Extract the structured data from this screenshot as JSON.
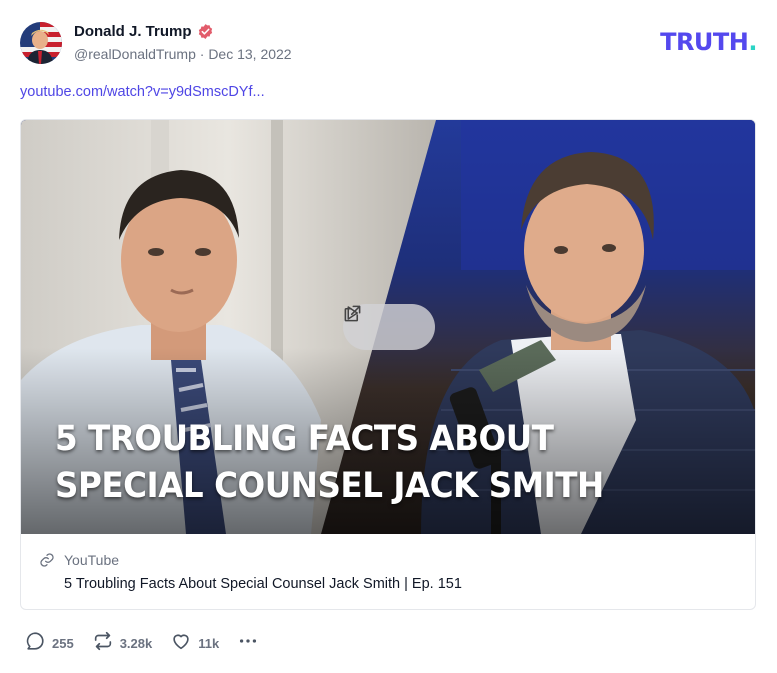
{
  "post": {
    "author": {
      "display_name": "Donald J. Trump",
      "handle": "@realDonaldTrump",
      "separator": "·",
      "date": "Dec 13, 2022",
      "verified": true
    },
    "brand_logo": {
      "text": "TRUTH",
      "dot": ".",
      "color": "#5448ee",
      "dot_color": "#2bd4c5"
    },
    "link_text": "youtube.com/watch?v=y9dSmscDYf...",
    "link_color": "#4f46e5",
    "media_card": {
      "thumbnail_text_line1": "5 TROUBLING FACTS ABOUT",
      "thumbnail_text_line2": "SPECIAL COUNSEL JACK SMITH",
      "provider": "YouTube",
      "title": "5 Troubling Facts About Special Counsel Jack Smith | Ep. 151",
      "controls": {
        "play_icon": "play-icon",
        "external_icon": "external-link-icon"
      }
    },
    "actions": {
      "replies": {
        "icon": "reply-icon",
        "count": "255"
      },
      "retruths": {
        "icon": "retruth-icon",
        "count": "3.28k"
      },
      "likes": {
        "icon": "heart-icon",
        "count": "11k"
      },
      "more": {
        "icon": "more-icon"
      }
    }
  }
}
